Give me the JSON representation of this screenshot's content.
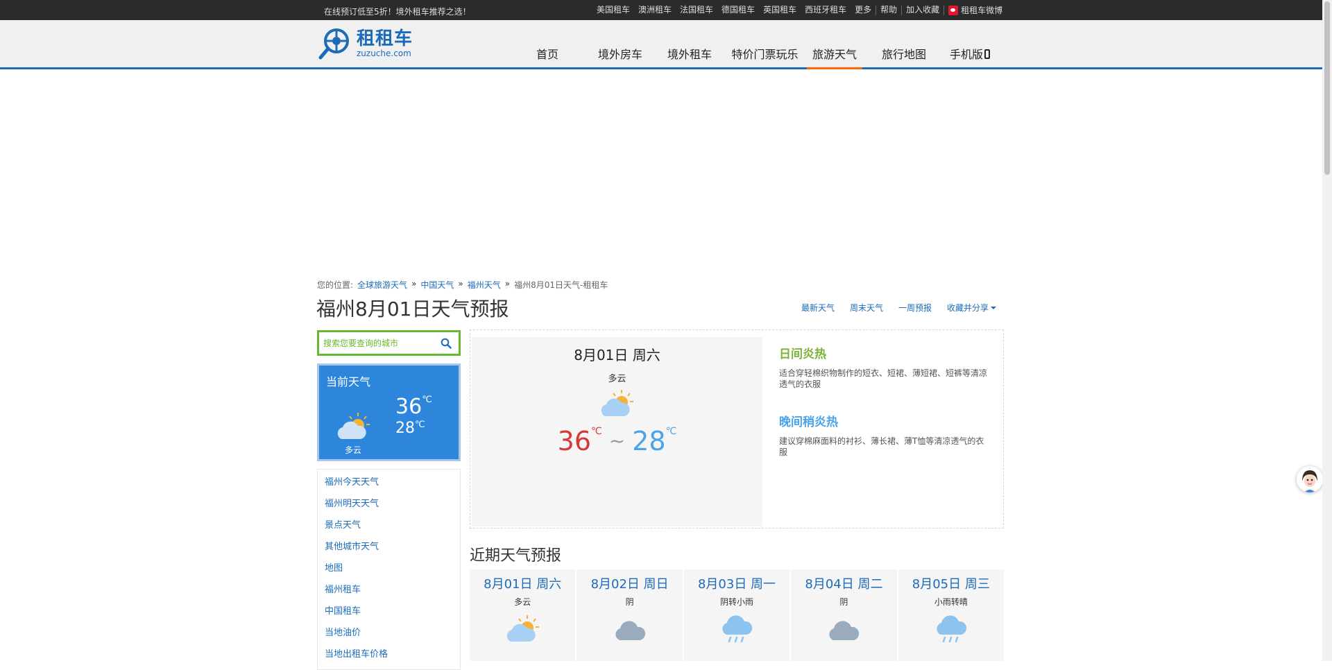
{
  "topbar": {
    "promo": "在线预订低至5折！境外租车推荐之选！",
    "links": [
      "美国租车",
      "澳洲租车",
      "法国租车",
      "德国租车",
      "英国租车",
      "西班牙租车",
      "更多",
      "帮助",
      "加入收藏"
    ],
    "weibo_label": "租租车微博"
  },
  "logo": {
    "cn": "租租车",
    "en": "zuzuche.com"
  },
  "nav": {
    "items": [
      "首页",
      "境外房车",
      "境外租车",
      "特价门票玩乐",
      "旅游天气",
      "旅行地图",
      "手机版"
    ],
    "active": "旅游天气"
  },
  "breadcrumb": {
    "prefix": "您的位置:",
    "items": [
      "全球旅游天气",
      "中国天气",
      "福州天气"
    ],
    "current": "福州8月01日天气-租租车",
    "sep": "»"
  },
  "page_title": "福州8月01日天气预报",
  "title_links": [
    "最新天气",
    "周末天气",
    "一周预报",
    "收藏并分享"
  ],
  "search": {
    "placeholder": "搜索您要查询的城市"
  },
  "current": {
    "title": "当前天气",
    "hi": "36",
    "lo": "28",
    "unit": "℃",
    "condition": "多云",
    "icon": "partly-cloudy-icon"
  },
  "side_links": [
    "福州今天天气",
    "福州明天天气",
    "景点天气",
    "其他城市天气",
    "地图",
    "福州租车",
    "中国租车",
    "当地油价",
    "当地出租车价格"
  ],
  "today": {
    "date": "8月01日 周六",
    "condition": "多云",
    "hi": "36",
    "lo": "28",
    "unit": "℃",
    "sep": "~",
    "day_tip_title": "日间炎热",
    "day_tip_text": "适合穿轻棉织物制作的短衣、短裙、薄短裙、短裤等清凉透气的衣服",
    "night_tip_title": "晚间稍炎热",
    "night_tip_text": "建议穿棉麻面料的衬衫、薄长裙、薄T恤等清凉透气的衣服"
  },
  "forecast": {
    "title": "近期天气预报",
    "days": [
      {
        "date": "8月01日 周六",
        "cond": "多云",
        "icon": "partly-cloudy-icon"
      },
      {
        "date": "8月02日 周日",
        "cond": "阴",
        "icon": "overcast-icon"
      },
      {
        "date": "8月03日 周一",
        "cond": "阴转小雨",
        "icon": "rain-icon"
      },
      {
        "date": "8月04日 周二",
        "cond": "阴",
        "icon": "overcast-icon"
      },
      {
        "date": "8月05日 周三",
        "cond": "小雨转晴",
        "icon": "rain-icon"
      }
    ]
  },
  "colors": {
    "brand_blue": "#1c6bb8",
    "nav_active": "#ff6a00",
    "search_green": "#6ab82d",
    "current_bg": "#2d86dc",
    "hot_red": "#d53a35",
    "cool_blue": "#4aa3e8",
    "day_tip_green": "#7ab23b"
  }
}
